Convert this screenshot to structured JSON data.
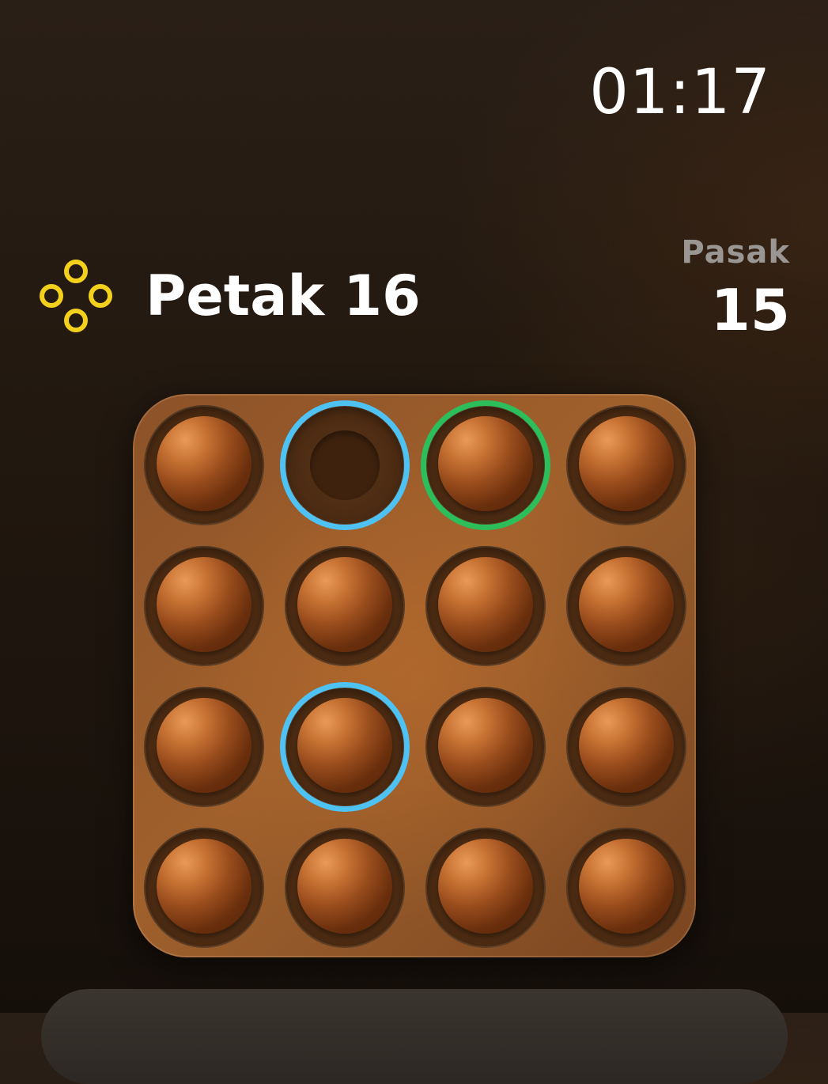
{
  "status": {
    "time": "01:17"
  },
  "header": {
    "icon": "four-rings-icon",
    "title": "Petak 16",
    "accent_color": "#f3d01b"
  },
  "counter": {
    "label": "Pasak",
    "value": "15"
  },
  "board": {
    "rows": 4,
    "cols": 4,
    "cells": [
      [
        {
          "peg": true,
          "ring": null
        },
        {
          "peg": false,
          "ring": "blue"
        },
        {
          "peg": true,
          "ring": "green"
        },
        {
          "peg": true,
          "ring": null
        }
      ],
      [
        {
          "peg": true,
          "ring": null
        },
        {
          "peg": true,
          "ring": null
        },
        {
          "peg": true,
          "ring": null
        },
        {
          "peg": true,
          "ring": null
        }
      ],
      [
        {
          "peg": true,
          "ring": null
        },
        {
          "peg": true,
          "ring": "blue"
        },
        {
          "peg": true,
          "ring": null
        },
        {
          "peg": true,
          "ring": null
        }
      ],
      [
        {
          "peg": true,
          "ring": null
        },
        {
          "peg": true,
          "ring": null
        },
        {
          "peg": true,
          "ring": null
        },
        {
          "peg": true,
          "ring": null
        }
      ]
    ],
    "colors": {
      "blue": "#4fc2f4",
      "green": "#2dbe5c"
    }
  }
}
